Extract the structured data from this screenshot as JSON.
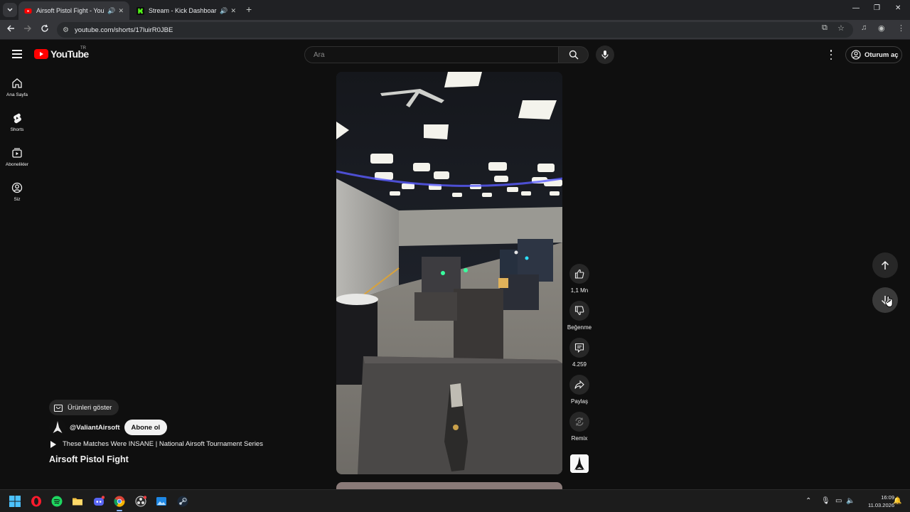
{
  "browser": {
    "tabs": [
      {
        "title": "Airsoft Pistol Fight - YouTube",
        "favicon": "youtube-favicon",
        "active": true
      },
      {
        "title": "Stream - Kick Dashboard",
        "favicon": "kick-favicon",
        "active": false
      }
    ],
    "url": "youtube.com/shorts/17luirR0JBE"
  },
  "header": {
    "logo_text": "YouTube",
    "country_code": "TR",
    "search_placeholder": "Ara",
    "signin_label": "Oturum aç"
  },
  "sidebar": {
    "items": [
      {
        "label": "Ana Sayfa",
        "icon": "home-icon"
      },
      {
        "label": "Shorts",
        "icon": "shorts-icon"
      },
      {
        "label": "Abonelikler",
        "icon": "subscriptions-icon"
      },
      {
        "label": "Siz",
        "icon": "you-icon"
      }
    ]
  },
  "short": {
    "title": "Airsoft Pistol Fight",
    "channel": "@ValiantAirsoft",
    "subscribe_label": "Abone ol",
    "products_label": "Ürünleri göster",
    "related_video": "These Matches Were INSANE | National Airsoft Tournament Series",
    "actions": {
      "like_count": "1,1 Mn",
      "dislike_label": "Beğenme",
      "comment_count": "4.259",
      "share_label": "Paylaş",
      "remix_label": "Remix"
    }
  },
  "taskbar": {
    "time": "16:09",
    "date": "11.03.2026"
  },
  "colors": {
    "background": "#0f0f0f",
    "youtube_red": "#ff0000",
    "chip": "#272727"
  }
}
